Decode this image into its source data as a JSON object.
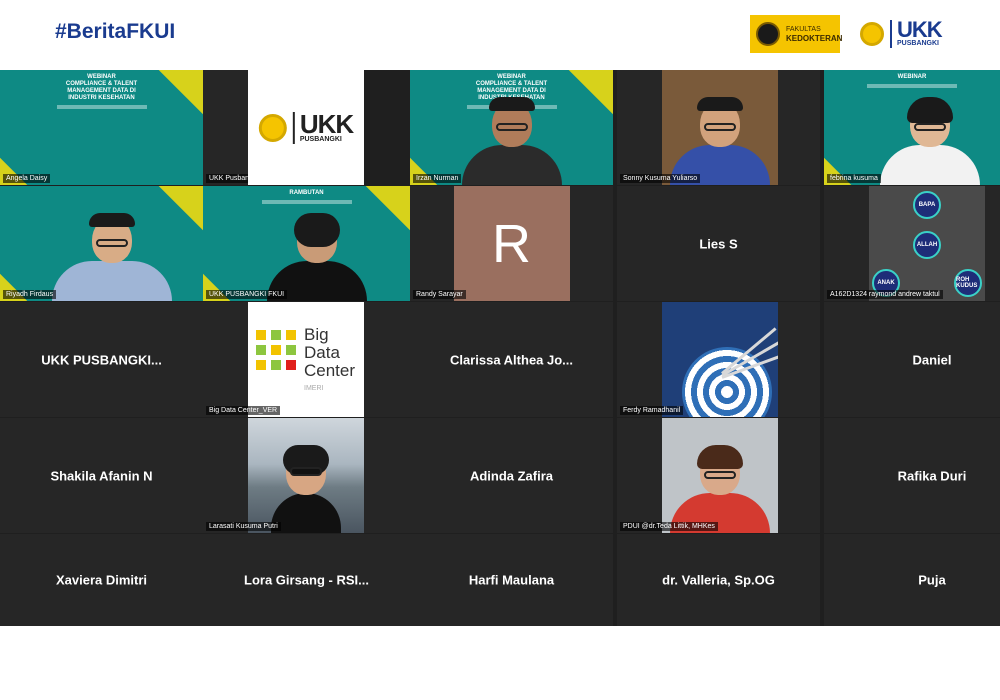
{
  "header": {
    "hashtag": "#BeritaFKUI",
    "logo_fk_title": "FAKULTAS",
    "logo_fk_sub": "KEDOKTERAN",
    "logo_ukk": "UKK",
    "logo_ukk_sub": "PUSBANGKI"
  },
  "webinar": {
    "banner_title": "WEBINAR",
    "banner_sub": "COMPLIANCE & TALENT MANAGEMENT DATA DI INDUSTRI KESEHATAN",
    "banner_alt_title": "RAMBUTAN",
    "rectangle_letter": "R"
  },
  "tiles": {
    "angela": "Angela Daisy",
    "ukk1": "UKK Pusbangki",
    "irzan": "Irzan Nurman",
    "sonny": "Sonny Kusuma Yuliarso",
    "febrina": "febrina kusuma",
    "riyadh": "Riyadh Firdaus",
    "ukk2": "UKK PUSBANGKI FKUI",
    "randy": "Randy Sarayar",
    "lies": "Lies S",
    "raymond": "A162D1324 raymond andrew taktul",
    "ukk3": "UKK  PUSBANGKI...",
    "bigdata": "Big Data Center_VER",
    "bigdata_logo": [
      "Big",
      "Data",
      "Center"
    ],
    "bigdata_logo_sub": "IMERI",
    "clarissa": "Clarissa  Althea  Jo...",
    "ferdy": "Ferdy Ramadhanil",
    "daniel": "Daniel",
    "shakila": "Shakila Afanin N",
    "larasati": "Larasati Kusuma Putri",
    "adinda": "Adinda Zafira",
    "pdui": "PDUI @dr.Teda Littik, MHKes",
    "rafika": "Rafika Duri",
    "xaviera": "Xaviera Dimitri",
    "lora": "Lora Girsang - RSI...",
    "harfi": "Harfi Maulana",
    "valleria": "dr. Valleria, Sp.OG",
    "puja": "Puja"
  },
  "trinity": {
    "top": "BAPA",
    "center": "ALLAH",
    "left": "ANAK",
    "right": "ROH KUDUS"
  },
  "colors": {
    "hashtag": "#1a3b8f",
    "teal": "#0e8a84",
    "accent_yellow": "#d7d21b",
    "tile_bg": "#262626"
  }
}
